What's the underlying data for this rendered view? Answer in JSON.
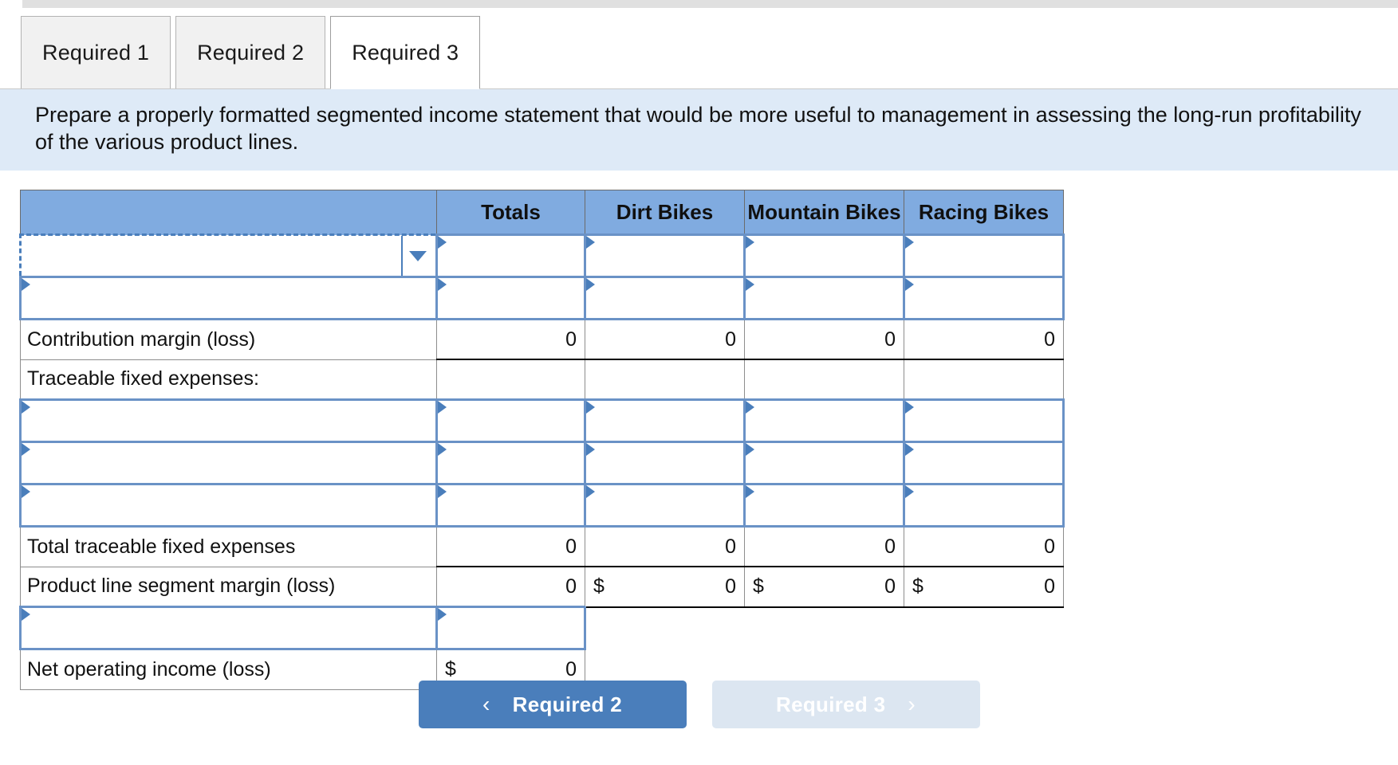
{
  "tabs": [
    {
      "label": "Required 1",
      "active": false
    },
    {
      "label": "Required 2",
      "active": false
    },
    {
      "label": "Required 3",
      "active": true
    }
  ],
  "instruction": "Prepare a properly formatted segmented income statement that would be more useful to management in assessing the long-run profitability of the various product lines.",
  "table": {
    "headers": [
      "",
      "Totals",
      "Dirt Bikes",
      "Mountain Bikes",
      "Racing Bikes"
    ],
    "rows": [
      {
        "type": "input-dropdown",
        "label": "",
        "totals": "",
        "dirt": "",
        "mountain": "",
        "racing": ""
      },
      {
        "type": "input",
        "label": "",
        "totals": "",
        "dirt": "",
        "mountain": "",
        "racing": ""
      },
      {
        "type": "computed",
        "label": "Contribution margin (loss)",
        "totals": "0",
        "dirt": "0",
        "mountain": "0",
        "racing": "0"
      },
      {
        "type": "static",
        "label": "Traceable fixed expenses:",
        "totals": "",
        "dirt": "",
        "mountain": "",
        "racing": ""
      },
      {
        "type": "input",
        "label": "",
        "totals": "",
        "dirt": "",
        "mountain": "",
        "racing": ""
      },
      {
        "type": "input",
        "label": "",
        "totals": "",
        "dirt": "",
        "mountain": "",
        "racing": ""
      },
      {
        "type": "input",
        "label": "",
        "totals": "",
        "dirt": "",
        "mountain": "",
        "racing": ""
      },
      {
        "type": "computed",
        "label": "Total traceable fixed expenses",
        "totals": "0",
        "dirt": "0",
        "mountain": "0",
        "racing": "0"
      },
      {
        "type": "computed-currency",
        "label": "Product line segment margin (loss)",
        "totals": "0",
        "dirt": "0",
        "mountain": "0",
        "racing": "0",
        "currency": "$"
      },
      {
        "type": "input-totals-only",
        "label": "",
        "totals": ""
      },
      {
        "type": "computed-currency-totals-only",
        "label": "Net operating income (loss)",
        "totals": "0",
        "currency": "$"
      }
    ]
  },
  "nav": {
    "prev_label": "Required 2",
    "prev_chevron": "‹",
    "next_label": "Required 3",
    "next_chevron": "›"
  },
  "colors": {
    "header_blue": "#80abe0",
    "banner_blue": "#deeaf7",
    "input_border": "#6a92c6",
    "button_blue": "#4a7ebb",
    "button_disabled": "#dce6f1"
  }
}
